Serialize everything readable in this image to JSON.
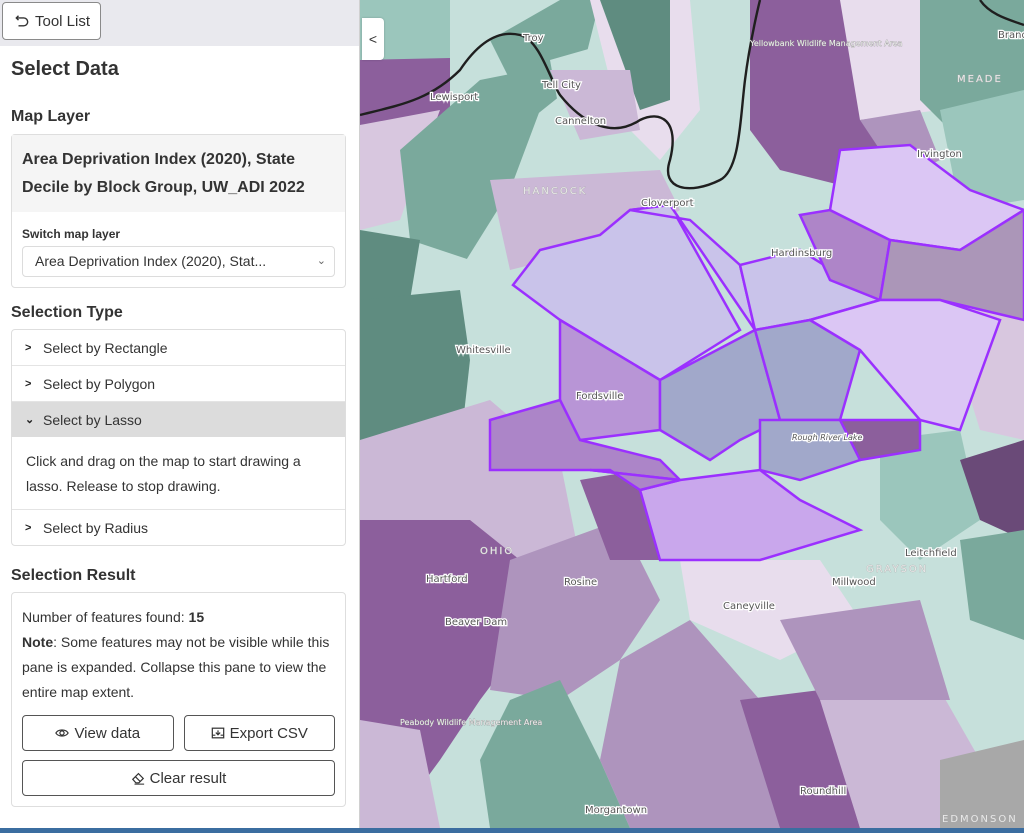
{
  "panel": {
    "tool_list_label": "Tool List",
    "title": "Select Data",
    "map_layer": {
      "heading": "Map Layer",
      "current_layer": "Area Deprivation Index (2020), State Decile by Block Group, UW_ADI 2022",
      "switch_label": "Switch map layer",
      "switch_selected": "Area Deprivation Index (2020), Stat..."
    },
    "selection_type": {
      "heading": "Selection Type",
      "items": [
        {
          "label": "Select by Rectangle",
          "expanded": false
        },
        {
          "label": "Select by Polygon",
          "expanded": false
        },
        {
          "label": "Select by Lasso",
          "expanded": true,
          "description": "Click and drag on the map to start drawing a lasso. Release to stop drawing."
        },
        {
          "label": "Select by Radius",
          "expanded": false
        }
      ]
    },
    "selection_result": {
      "heading": "Selection Result",
      "count_label": "Number of features found: ",
      "count": "15",
      "note_label": "Note",
      "note_text": ": Some features may not be visible while this pane is expanded. Collapse this pane to view the entire map extent.",
      "view_data_label": "View data",
      "export_csv_label": "Export CSV",
      "clear_label": "Clear result"
    }
  },
  "map": {
    "collapse_icon": "chevron-left-icon",
    "selection_outline_color": "#9b30ff",
    "place_labels": [
      "Troy",
      "Tell City",
      "Cannelton",
      "Lewisport",
      "Cloverport",
      "Irvington",
      "Hardinsburg",
      "Whitesville",
      "Fordsville",
      "Leitchfield",
      "Millwood",
      "Caneyville",
      "Hartford",
      "Rosine",
      "Beaver Dam",
      "Morgantown",
      "Roundhill",
      "Brand"
    ],
    "county_labels": [
      "HANCOCK",
      "MEADE",
      "OHIO",
      "GRAYSON",
      "EDMONSON"
    ],
    "area_labels": [
      "Yellowbank Wildlife Management Area",
      "Peabody Wildlife Management Area",
      "Rough River Lake"
    ],
    "features_selected": 15
  }
}
